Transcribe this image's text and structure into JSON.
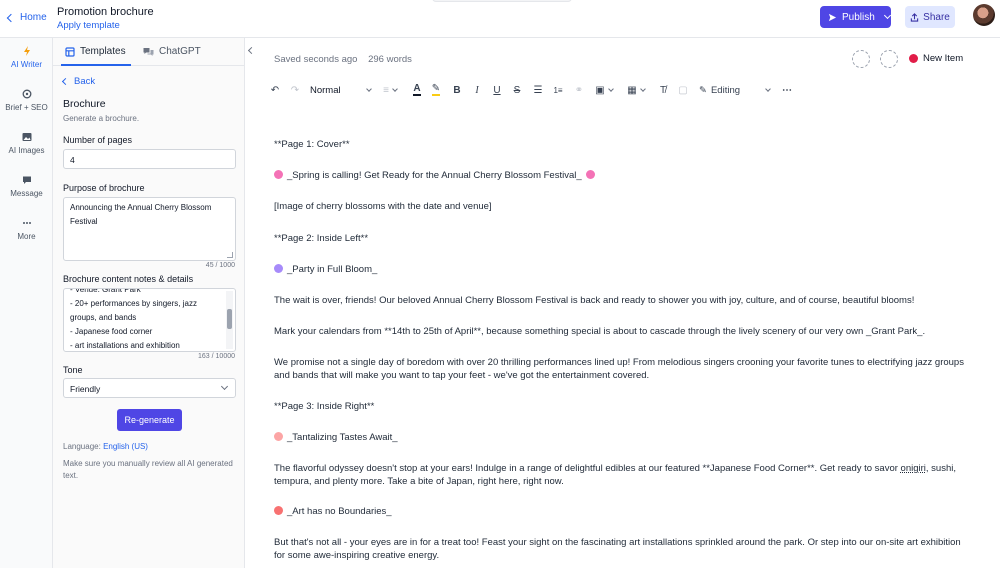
{
  "topbar": {
    "home_label": "Home",
    "doc_title": "Promotion brochure",
    "apply_template": "Apply template",
    "publish_label": "Publish",
    "share_label": "Share"
  },
  "rail": {
    "items": [
      {
        "label": "AI Writer",
        "icon": "bolt-icon"
      },
      {
        "label": "Brief + SEO",
        "icon": "target-icon"
      },
      {
        "label": "AI Images",
        "icon": "image-icon"
      },
      {
        "label": "Message",
        "icon": "chat-icon"
      },
      {
        "label": "More",
        "icon": "dots-icon"
      }
    ]
  },
  "panel": {
    "tabs": [
      {
        "label": "Templates"
      },
      {
        "label": "ChatGPT"
      }
    ],
    "back_label": "Back",
    "title": "Brochure",
    "subtitle": "Generate a brochure.",
    "pages_label": "Number of pages",
    "pages_value": "4",
    "purpose_label": "Purpose of brochure",
    "purpose_value": "Announcing the Annual Cherry Blossom Festival",
    "purpose_counter": "45 / 1000",
    "notes_label": "Brochure content notes & details",
    "notes_lines": [
      "- Venue: Grant Park",
      "- 20+ performances by singers, jazz",
      "groups, and bands",
      "- Japanese food corner",
      "- art installations and exhibition"
    ],
    "notes_counter": "163 / 10000",
    "tone_label": "Tone",
    "tone_value": "Friendly",
    "regenerate_label": "Re-generate",
    "language_prefix": "Language:",
    "language_value": "English (US)",
    "disclaimer": "Make sure you manually review all AI generated text."
  },
  "editor": {
    "saved_status": "Saved seconds ago",
    "word_count": "296 words",
    "new_item_label": "New Item",
    "style_select": "Normal",
    "editing_mode": "Editing",
    "accent_color": "#4f46e5"
  },
  "doc": {
    "p1": "**Page 1: Cover**",
    "p2": "_Spring is calling! Get Ready for the Annual Cherry Blossom Festival_",
    "p3": "[Image of cherry blossoms with the date and venue]",
    "p4": "**Page 2: Inside Left**",
    "p5": "_Party in Full Bloom_",
    "p6": "The wait is over, friends! Our beloved Annual Cherry Blossom Festival is back and ready to shower you with joy, culture, and of course, beautiful blooms!",
    "p7": "Mark your calendars from **14th to 25th of April**, because something special is about to cascade through the lively scenery of our very own _Grant Park_.",
    "p8": "We promise not a single day of boredom with over 20 thrilling performances lined up! From melodious singers crooning your favorite tunes to electrifying jazz groups and bands that will make you want to tap your feet - we've got the entertainment covered.",
    "p9": "**Page 3: Inside Right**",
    "p10": "_Tantalizing Tastes Await_",
    "p11a": "The flavorful odyssey doesn't stop at your ears! Indulge in a range of delightful edibles at our featured **Japanese Food Corner**. Get ready to savor ",
    "p11b": "onigiri",
    "p11c": ", sushi, tempura, and plenty more. Take a bite of Japan, right here, right now.",
    "p12": "_Art has no Boundaries_",
    "p13": "But that's not all - your eyes are in for a treat too! Feast your sight on the fascinating art installations sprinkled around the park. Or step into our on-site art exhibition for some awe-inspiring creative energy."
  }
}
